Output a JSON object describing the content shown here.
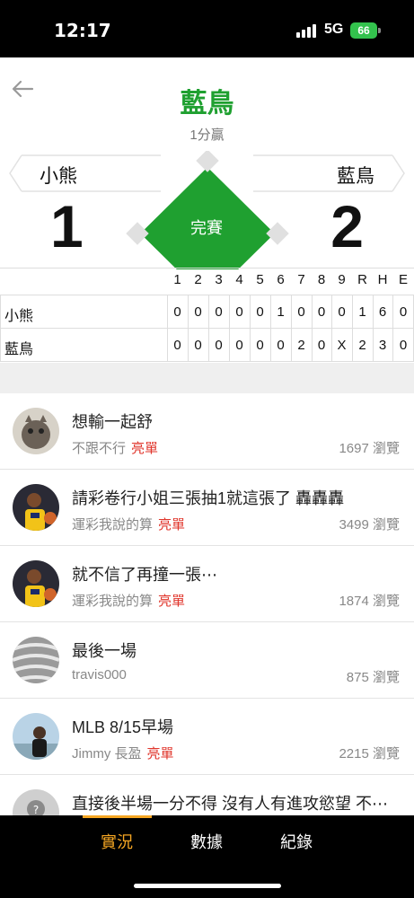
{
  "status_bar": {
    "time": "12:17",
    "network": "5G",
    "battery": "66"
  },
  "header": {
    "winner": "藍鳥",
    "margin_text": "1分贏",
    "game_status": "完賽",
    "away_team": "小熊",
    "home_team": "藍鳥",
    "away_score": "1",
    "home_score": "2"
  },
  "linescore": {
    "columns": [
      "1",
      "2",
      "3",
      "4",
      "5",
      "6",
      "7",
      "8",
      "9",
      "R",
      "H",
      "E"
    ],
    "rows": [
      {
        "team": "小熊",
        "cells": [
          "0",
          "0",
          "0",
          "0",
          "0",
          "1",
          "0",
          "0",
          "0",
          "1",
          "6",
          "0"
        ]
      },
      {
        "team": "藍鳥",
        "cells": [
          "0",
          "0",
          "0",
          "0",
          "0",
          "0",
          "2",
          "0",
          "X",
          "2",
          "3",
          "0"
        ]
      }
    ]
  },
  "posts": [
    {
      "title": "想輸一起舒",
      "author": "不跟不行",
      "badge": "亮單",
      "views": "1697 瀏覽",
      "avatar": "cat-avatar"
    },
    {
      "title": "請彩卷行小姐三張抽1就這張了 轟轟轟",
      "author": "運彩我說的算",
      "badge": "亮單",
      "views": "3499 瀏覽",
      "avatar": "basketball-player-avatar"
    },
    {
      "title": "就不信了再撞一張⋯",
      "author": "運彩我說的算",
      "badge": "亮單",
      "views": "1874 瀏覽",
      "avatar": "basketball-player-avatar"
    },
    {
      "title": "最後一場",
      "author": "travis000",
      "badge": "",
      "views": "875 瀏覽",
      "avatar": "fabric-avatar"
    },
    {
      "title": "MLB 8/15早場",
      "author": "Jimmy 長盈",
      "badge": "亮單",
      "views": "2215 瀏覽",
      "avatar": "person-avatar"
    },
    {
      "title": "直接後半場一分不得 沒有人有進攻慾望 不⋯",
      "author": "",
      "badge": "",
      "views": "",
      "avatar": "default-avatar"
    }
  ],
  "tabs": [
    {
      "label": "實況",
      "active": true
    },
    {
      "label": "數據",
      "active": false
    },
    {
      "label": "紀錄",
      "active": false
    }
  ],
  "colors": {
    "accent_green": "#1fa030",
    "badge_red": "#e0362c",
    "tab_active": "#f5a623"
  }
}
